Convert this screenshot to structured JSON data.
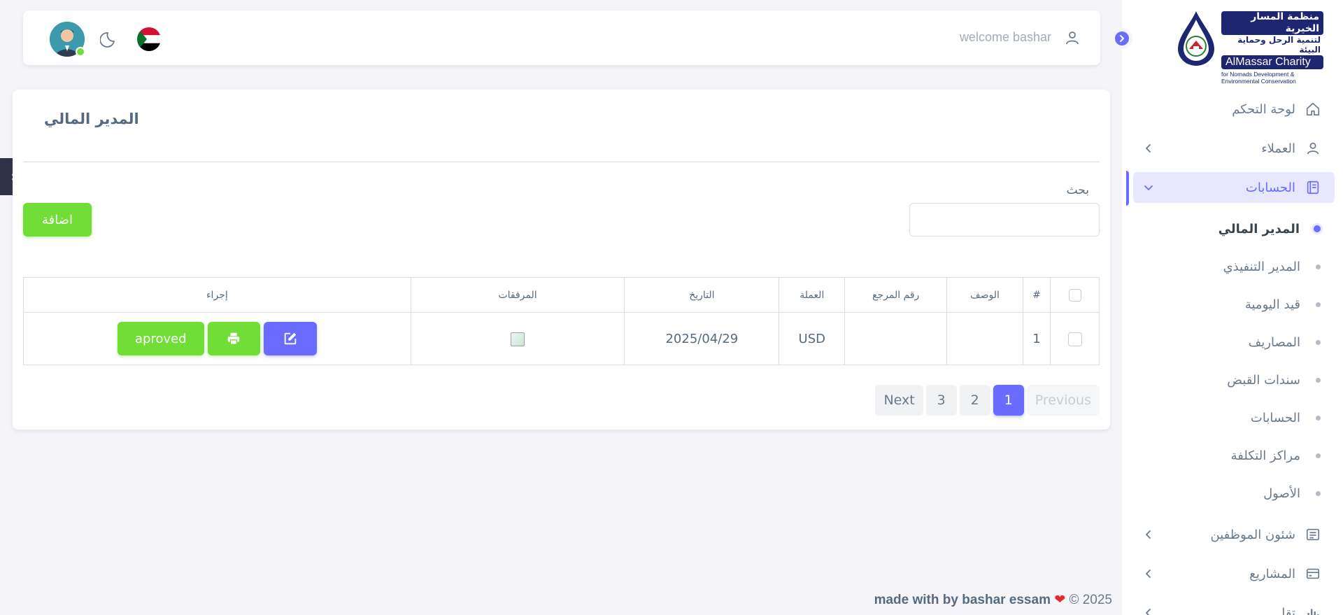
{
  "brand": {
    "arabic_line1": "منظمة المسار الخيرية",
    "arabic_line2": "لتنمية الرحل وحماية البيئة",
    "english_name": "AlMassar Charity",
    "english_sub1": "for Nomads Development &",
    "english_sub2": "Environmental Conservation"
  },
  "navbar": {
    "welcome": "welcome bashar",
    "icons": [
      "user-icon",
      "moon-icon",
      "sudan-flag",
      "avatar"
    ]
  },
  "sidebar": {
    "items": [
      {
        "label": "لوحة التحكم",
        "icon": "home-icon"
      },
      {
        "label": "العملاء",
        "icon": "user-icon"
      },
      {
        "label": "الحسابات",
        "icon": "book-icon"
      }
    ],
    "submenu": [
      {
        "label": "المدير المالي"
      },
      {
        "label": "المدير التنفيذي"
      },
      {
        "label": "قيد اليومية"
      },
      {
        "label": "المصاريف"
      },
      {
        "label": "سندات القبض"
      },
      {
        "label": "الحسابات"
      },
      {
        "label": "مراكز التكلفة"
      },
      {
        "label": "الأصول"
      }
    ],
    "bottom_items": [
      {
        "label": "شئون الموظفين",
        "icon": "document-icon"
      },
      {
        "label": "المشاريع",
        "icon": "card-icon"
      },
      {
        "label": "تقا",
        "icon": "chart-icon"
      }
    ]
  },
  "page": {
    "title": "المدير المالي",
    "search_label": "بحث",
    "add_button": "اضافة"
  },
  "table": {
    "headers": {
      "number": "#",
      "description": "الوصف",
      "reference": "رقم المرجع",
      "currency": "العملة",
      "date": "التاريخ",
      "attachments": "المرفقات",
      "action": "إجراء"
    },
    "rows": [
      {
        "number": "1",
        "description": "",
        "reference": "",
        "currency": "USD",
        "date": "2025/04/29",
        "approved_label": "aproved"
      }
    ]
  },
  "pagination": {
    "previous": "Previous",
    "pages": [
      "1",
      "2",
      "3"
    ],
    "current": "1",
    "next": "Next"
  },
  "footer": {
    "copyright": "© 2025",
    "made_with": "made with",
    "by": "by bashar essam"
  },
  "colors": {
    "primary": "#696cff",
    "success": "#71dd37",
    "background": "#f5f5f9"
  }
}
